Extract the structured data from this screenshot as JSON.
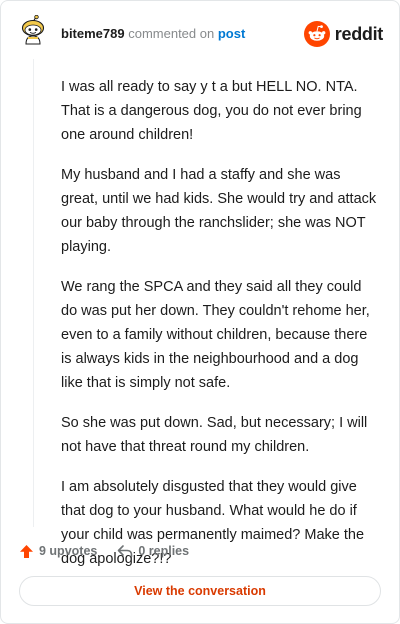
{
  "header": {
    "username": "biteme789",
    "commented_on_text": "commented on",
    "post_link": "post",
    "logo_text": "reddit"
  },
  "comment": {
    "paragraphs": [
      "I was all ready to say y t a but HELL NO. NTA. That is a dangerous dog, you do not ever bring one around children!",
      "My husband and I had a staffy and she was great, until we had kids. She would try and attack our baby through the ranchslider; she was NOT playing.",
      "We rang the SPCA and they said all they could do was put her down. They couldn't rehome her, even to a family without children, because there is always kids in the neighbourhood and a dog like that is simply not safe.",
      "So she was put down. Sad, but necessary; I will not have that threat round my children.",
      "I am absolutely disgusted that they would give that dog to your husband. What would he do if your child was permanently maimed? Make the dog apologize?!?"
    ]
  },
  "actions": {
    "upvotes": "9 upvotes",
    "replies": "0 replies"
  },
  "cta": {
    "label": "View the conversation"
  },
  "colors": {
    "accent": "#ff4500",
    "cta_text": "#d93a00",
    "link": "#0079d3",
    "muted": "#878a8c"
  },
  "icons": {
    "avatar": "snoo-avatar-icon",
    "logo": "reddit-snoo-icon",
    "upvote": "upvote-arrow-icon",
    "reply": "reply-arrow-icon"
  }
}
